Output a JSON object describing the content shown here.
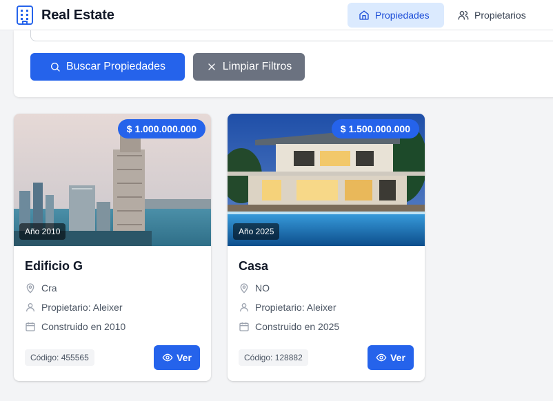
{
  "app": {
    "title": "Real Estate",
    "brand_icon": "building-icon"
  },
  "nav": {
    "items": [
      {
        "label": "Propiedades",
        "icon": "home-icon",
        "active": true
      },
      {
        "label": "Propietarios",
        "icon": "users-icon",
        "active": false
      }
    ]
  },
  "filters": {
    "search_label": "Buscar Propiedades",
    "search_icon": "search-icon",
    "clear_label": "Limpiar Filtros",
    "clear_icon": "x-icon"
  },
  "properties": [
    {
      "name": "Edificio G",
      "price": "$ 1.000.000.000",
      "year_badge": "Año 2010",
      "address": "Cra",
      "owner": "Propietario: Aleixer",
      "built": "Construido en 2010",
      "code": "Código: 455565",
      "view_label": "Ver"
    },
    {
      "name": "Casa",
      "price": "$ 1.500.000.000",
      "year_badge": "Año 2025",
      "address": "NO",
      "owner": "Propietario: Aleixer",
      "built": "Construido en 2025",
      "code": "Código: 128882",
      "view_label": "Ver"
    }
  ],
  "colors": {
    "primary": "#2563eb",
    "primary_light": "#dbeafe",
    "secondary": "#6b7280",
    "background": "#f3f4f6"
  }
}
